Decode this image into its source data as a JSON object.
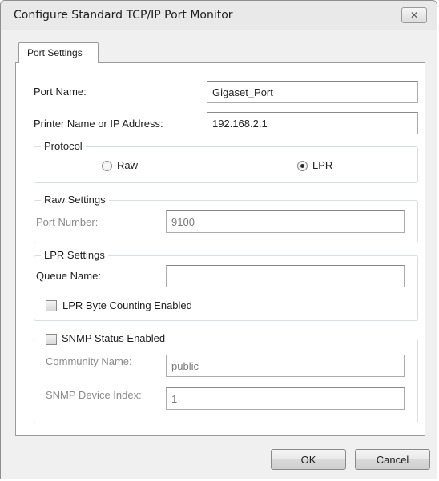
{
  "window": {
    "title": "Configure Standard TCP/IP Port Monitor"
  },
  "icons": {
    "close": "close-icon"
  },
  "close_glyph": "✕",
  "tab": {
    "label": "Port Settings"
  },
  "port_name": {
    "label": "Port Name:",
    "value": "Gigaset_Port"
  },
  "printer_address": {
    "label": "Printer Name or IP Address:",
    "value": "192.168.2.1"
  },
  "protocol": {
    "title": "Protocol",
    "raw_label": "Raw",
    "lpr_label": "LPR",
    "selected": "LPR"
  },
  "raw_settings": {
    "title": "Raw Settings",
    "port_number_label": "Port Number:",
    "port_number_value": "9100"
  },
  "lpr_settings": {
    "title": "LPR Settings",
    "queue_name_label": "Queue Name:",
    "queue_name_value": "",
    "byte_counting_label": "LPR Byte Counting Enabled",
    "byte_counting_checked": false
  },
  "snmp": {
    "label": "SNMP Status Enabled",
    "checked": false,
    "community_label": "Community Name:",
    "community_value": "public",
    "device_index_label": "SNMP Device Index:",
    "device_index_value": "1"
  },
  "buttons": {
    "ok": "OK",
    "cancel": "Cancel"
  }
}
